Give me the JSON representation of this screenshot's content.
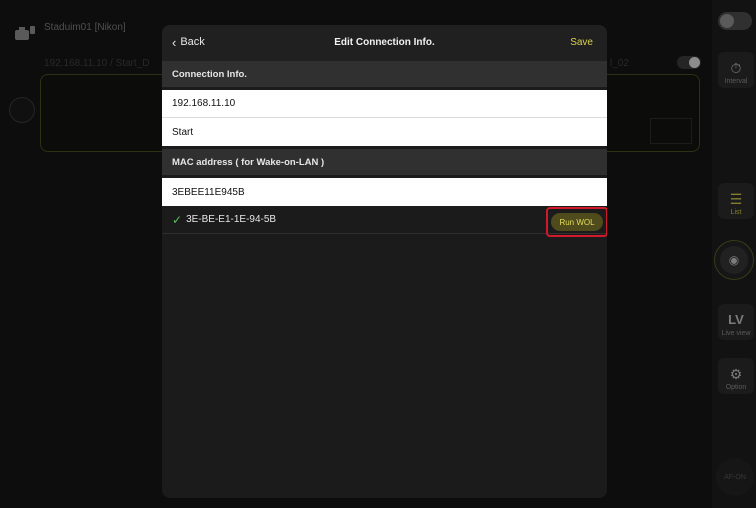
{
  "background": {
    "camera_title": "Staduim01 [Nikon]",
    "connection_line": "192.168.11.10 / Start_D",
    "right_label": "l_02"
  },
  "rail": {
    "interval_label": "Interval",
    "list_label": "List",
    "lv_label": "LV",
    "lv_caption": "Live view",
    "option_label": "Option",
    "afon_label": "AF-ON"
  },
  "modal": {
    "back_label": "Back",
    "title": "Edit Connection Info.",
    "save_label": "Save",
    "connection_section": "Connection Info.",
    "ip_address": "192.168.11.10",
    "name": "Start",
    "mac_section": "MAC address ( for Wake-on-LAN )",
    "mac_input": "3EBEE11E945B",
    "mac_formatted": "3E-BE-E1-1E-94-5B",
    "run_wol_label": "Run WOL"
  },
  "colors": {
    "accent": "#d9d24a",
    "highlight": "#d2192b",
    "check": "#58c25a"
  }
}
